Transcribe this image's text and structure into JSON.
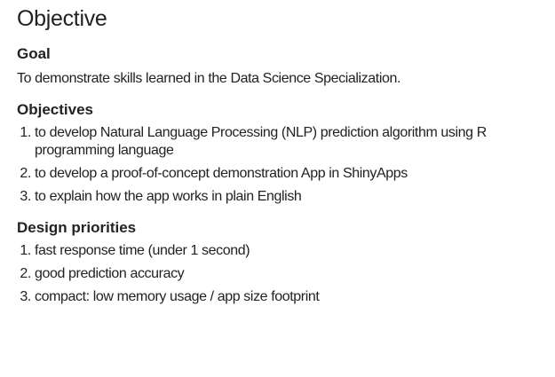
{
  "title": "Objective",
  "goal": {
    "heading": "Goal",
    "text": "To demonstrate skills learned in the Data Science Specialization."
  },
  "objectives": {
    "heading": "Objectives",
    "items": [
      "to develop Natural Language Processing (NLP) prediction algorithm using R programming language",
      "to develop a proof-of-concept demonstration App in ShinyApps",
      "to explain how the app works in plain English"
    ]
  },
  "design": {
    "heading": "Design priorities",
    "items": [
      "fast response time (under 1 second)",
      "good prediction accuracy",
      "compact: low memory usage / app size footprint"
    ]
  }
}
